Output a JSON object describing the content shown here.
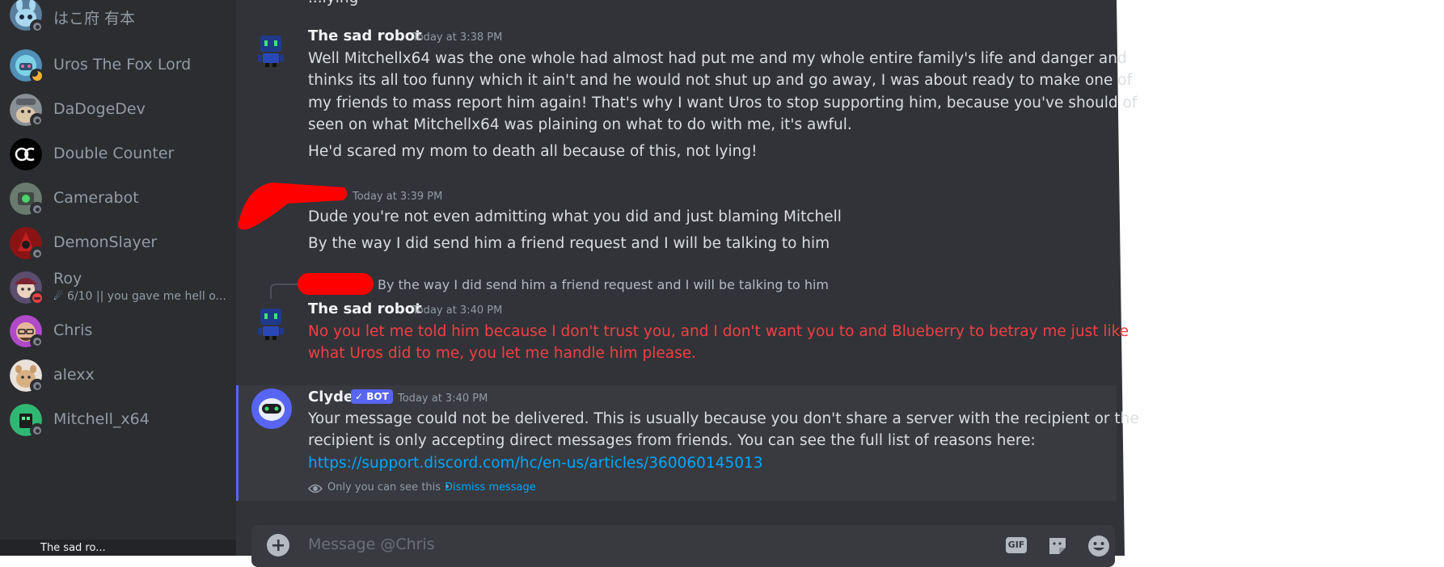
{
  "sidebar": {
    "dms": [
      {
        "name": "はこ府 有本",
        "status": "offline"
      },
      {
        "name": "Uros The Fox Lord",
        "status": "idle"
      },
      {
        "name": "DaDogeDev",
        "status": "offline"
      },
      {
        "name": "Double Counter",
        "status": "none"
      },
      {
        "name": "Camerabot",
        "status": "offline"
      },
      {
        "name": "DemonSlayer",
        "status": "offline"
      },
      {
        "name": "Roy",
        "sub": "6/10 || you gave me hell o...",
        "status": "dnd"
      },
      {
        "name": "Chris",
        "status": "offline"
      },
      {
        "name": "alexx",
        "status": "offline"
      },
      {
        "name": "Mitchell_x64",
        "status": "offline"
      }
    ],
    "user_panel_name": "The sad ro..."
  },
  "chat": {
    "top_fragment": "...lying",
    "messages": [
      {
        "author": "The sad robot",
        "time": "Today at 3:38 PM",
        "lines": [
          "Well Mitchellx64 was the one whole had almost had put me and my whole entire family's life and danger and",
          "thinks its all too funny which it ain't and he would not shut up and go away, I was about ready to make one of",
          "my friends to mass report him again! That's why I want Uros to stop supporting him, because you've should of",
          "seen on what Mitchellx64 was plaining on what to do with me, it's awful."
        ],
        "followup": "He'd scared my mom to death all because of this, not lying!"
      },
      {
        "author": "",
        "time": "Today at 3:39 PM",
        "lines": [
          "Dude you're not even admitting what you did and just blaming Mitchell"
        ],
        "followup": "By the way I did send him a friend request and I will be talking to him"
      },
      {
        "reply_to": "By the way I did send him a friend request and I will be talking to him",
        "author": "The sad robot",
        "time": "Today at 3:40 PM",
        "lines": [
          "No you let me told him because I don't trust you, and I don't want you to and Blueberry to betray me just like",
          "what Uros did to me, you let me handle him please."
        ]
      }
    ],
    "clyde": {
      "author": "Clyde",
      "bot_tag": "BOT",
      "time": "Today at 3:40 PM",
      "lines": [
        "Your message could not be delivered. This is usually because you don't share a server with the recipient or the",
        "recipient is only accepting direct messages from friends. You can see the full list of reasons here:"
      ],
      "link": "https://support.discord.com/hc/en-us/articles/360060145013",
      "only_you": "Only you can see this •",
      "dismiss": "Dismiss message"
    },
    "composer": {
      "placeholder": "Message @Chris",
      "gif_label": "GIF"
    }
  },
  "colors": {
    "sidebar_bg": "#2b2d31",
    "chat_bg": "#313338",
    "blurple": "#5865f2",
    "error_red": "#f23f43",
    "link": "#00a8fc"
  }
}
